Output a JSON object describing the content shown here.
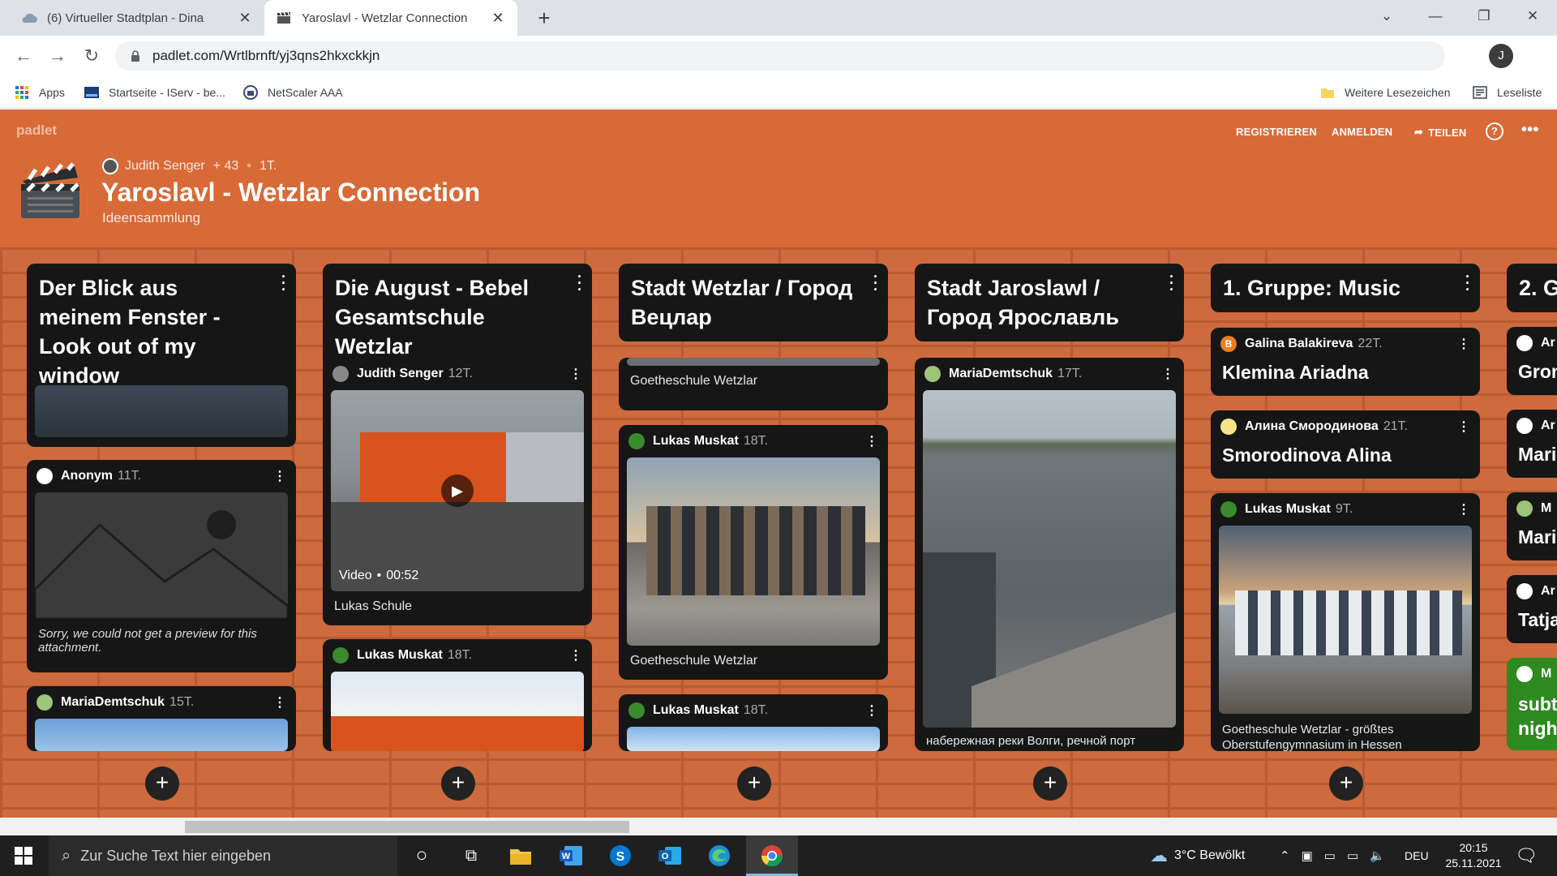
{
  "browser": {
    "tabs": [
      {
        "title": "(6) Virtueller Stadtplan - Dina",
        "active": false
      },
      {
        "title": "Yaroslavl - Wetzlar Connection",
        "active": true
      }
    ],
    "url": "padlet.com/Wrtlbrnft/yj3qns2hkxckkjn",
    "profile_initial": "J",
    "bookmarks": [
      {
        "label": "Apps",
        "icon": "apps-grid-icon"
      },
      {
        "label": "Startseite - IServ - be...",
        "icon": "iserv-icon"
      },
      {
        "label": "NetScaler AAA",
        "icon": "netscaler-icon"
      }
    ],
    "bookmarks_right": [
      {
        "label": "Weitere Lesezeichen",
        "icon": "folder-icon"
      },
      {
        "label": "Leseliste",
        "icon": "reading-list-icon"
      }
    ]
  },
  "padlet": {
    "logo": "padlet",
    "nav": {
      "register": "REGISTRIEREN",
      "login": "ANMELDEN",
      "share": "TEILEN"
    },
    "author": "Judith Senger",
    "contributors": "+ 43",
    "separator": "•",
    "age": "1T.",
    "title": "Yaroslavl - Wetzlar Connection",
    "subtitle": "Ideensammlung",
    "colors": {
      "header": "#d86a37",
      "card": "#161616",
      "brick": "#cd6a3e"
    },
    "columns": [
      {
        "title": "Der Blick aus meinem Fenster - Look out of my window",
        "cards": [
          {
            "author": "Anonym",
            "age": "11T.",
            "note": "Sorry, we could not get a preview for this attachment."
          },
          {
            "author": "MariaDemtschuk",
            "age": "15T."
          }
        ]
      },
      {
        "title": "Die August - Bebel Gesamtschule Wetzlar",
        "cards": [
          {
            "author": "Judith Senger",
            "age": "12T.",
            "media": "Video",
            "dot": "•",
            "duration": "00:52",
            "caption": "Lukas Schule"
          },
          {
            "author": "Lukas Muskat",
            "age": "18T."
          }
        ]
      },
      {
        "title": "Stadt Wetzlar / Город Вецлар",
        "cards": [
          {
            "caption": "Goetheschule Wetzlar"
          },
          {
            "author": "Lukas Muskat",
            "age": "18T.",
            "caption": "Goetheschule Wetzlar"
          },
          {
            "author": "Lukas Muskat",
            "age": "18T."
          }
        ]
      },
      {
        "title": "Stadt Jaroslawl / Город Ярославль",
        "cards": [
          {
            "author": "MariaDemtschuk",
            "age": "17T.",
            "caption": "набережная реки Волги, речной порт"
          }
        ]
      },
      {
        "title": "1. Gruppe: Music",
        "cards": [
          {
            "author": "Galina Balakireva",
            "age": "22T.",
            "initial": "B",
            "text": "Klemina Ariadna"
          },
          {
            "author": "Алина Смородинова",
            "age": "21T.",
            "text": "Smorodinova Alina"
          },
          {
            "author": "Lukas Muskat",
            "age": "9T.",
            "caption": "Goetheschule Wetzlar - größtes Oberstufengymnasium in Hessen"
          }
        ]
      },
      {
        "title": "2. G",
        "cards": [
          {
            "author": "Ar",
            "text": "Gron"
          },
          {
            "author": "Ar",
            "text": "Mari"
          },
          {
            "author": "M",
            "text": "Mari"
          },
          {
            "author": "Ar",
            "text": "Tatja"
          },
          {
            "author": "M",
            "text": "subt nigh"
          }
        ]
      }
    ]
  },
  "taskbar": {
    "search_placeholder": "Zur Suche Text hier eingeben",
    "weather": "3°C  Bewölkt",
    "lang": "DEU",
    "time": "20:15",
    "date": "25.11.2021"
  }
}
